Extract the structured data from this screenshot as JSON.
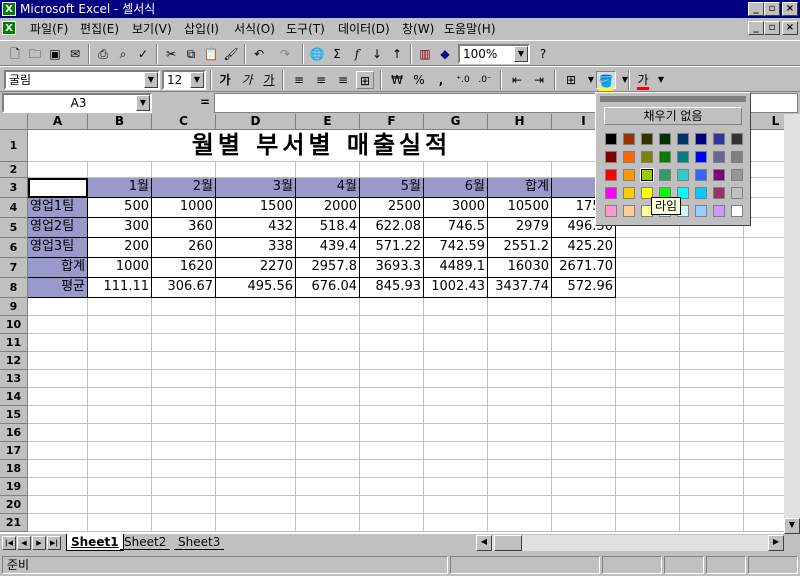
{
  "window": {
    "title": "Microsoft Excel - 셀서식",
    "app_icon": "excel-icon",
    "controls": [
      "_",
      "▫",
      "×"
    ]
  },
  "menu": [
    "파일(F)",
    "편집(E)",
    "보기(V)",
    "삽입(I)",
    "서식(O)",
    "도구(T)",
    "데이터(D)",
    "창(W)",
    "도움말(H)"
  ],
  "toolbar": {
    "zoom": "100%",
    "font_name": "굴림",
    "font_size": "12"
  },
  "formula_bar": {
    "name_box": "A3",
    "equals": "="
  },
  "columns": [
    "A",
    "B",
    "C",
    "D",
    "E",
    "F",
    "G",
    "H",
    "I",
    "L"
  ],
  "rows": [
    "1",
    "2",
    "3",
    "4",
    "5",
    "6",
    "7",
    "8",
    "9",
    "10",
    "11",
    "12",
    "13",
    "14",
    "15",
    "16",
    "17",
    "18",
    "19",
    "20",
    "21"
  ],
  "sheet": {
    "title": "월별 부서별 매출실적",
    "header": [
      "",
      "1월",
      "2월",
      "3월",
      "4월",
      "5월",
      "6월",
      "합계",
      "평"
    ],
    "data": [
      [
        "영업1팀",
        "500",
        "1000",
        "1500",
        "2000",
        "2500",
        "3000",
        "10500",
        "1750."
      ],
      [
        "영업2팀",
        "300",
        "360",
        "432",
        "518.4",
        "622.08",
        "746.5",
        "2979",
        "496.50"
      ],
      [
        "영업3팀",
        "200",
        "260",
        "338",
        "439.4",
        "571.22",
        "742.59",
        "2551.2",
        "425.20"
      ],
      [
        "합계",
        "1000",
        "1620",
        "2270",
        "2957.8",
        "3693.3",
        "4489.1",
        "16030",
        "2671.70"
      ],
      [
        "평균",
        "111.11",
        "306.67",
        "495.56",
        "676.04",
        "845.93",
        "1002.43",
        "3437.74",
        "572.96"
      ]
    ]
  },
  "fill_palette": {
    "no_fill_label": "채우기 없음",
    "tooltip": "라임",
    "colors": [
      [
        "#000000",
        "#993300",
        "#333300",
        "#003300",
        "#003366",
        "#000080",
        "#333399",
        "#333333"
      ],
      [
        "#800000",
        "#FF6600",
        "#808000",
        "#008000",
        "#008080",
        "#0000FF",
        "#666699",
        "#808080"
      ],
      [
        "#FF0000",
        "#FF9900",
        "#99CC00",
        "#339966",
        "#33CCCC",
        "#3366FF",
        "#800080",
        "#969696"
      ],
      [
        "#FF00FF",
        "#FFCC00",
        "#FFFF00",
        "#00FF00",
        "#00FFFF",
        "#00CCFF",
        "#993366",
        "#C0C0C0"
      ],
      [
        "#FF99CC",
        "#FFCC99",
        "#FFFF99",
        "#CCFFCC",
        "#CCFFFF",
        "#99CCFF",
        "#CC99FF",
        "#FFFFFF"
      ]
    ]
  },
  "tabs": [
    "Sheet1",
    "Sheet2",
    "Sheet3"
  ],
  "status": "준비",
  "colors": {
    "title_bar": "#000080",
    "header_fill": "#9999CC",
    "chrome": "#C0C0C0"
  }
}
